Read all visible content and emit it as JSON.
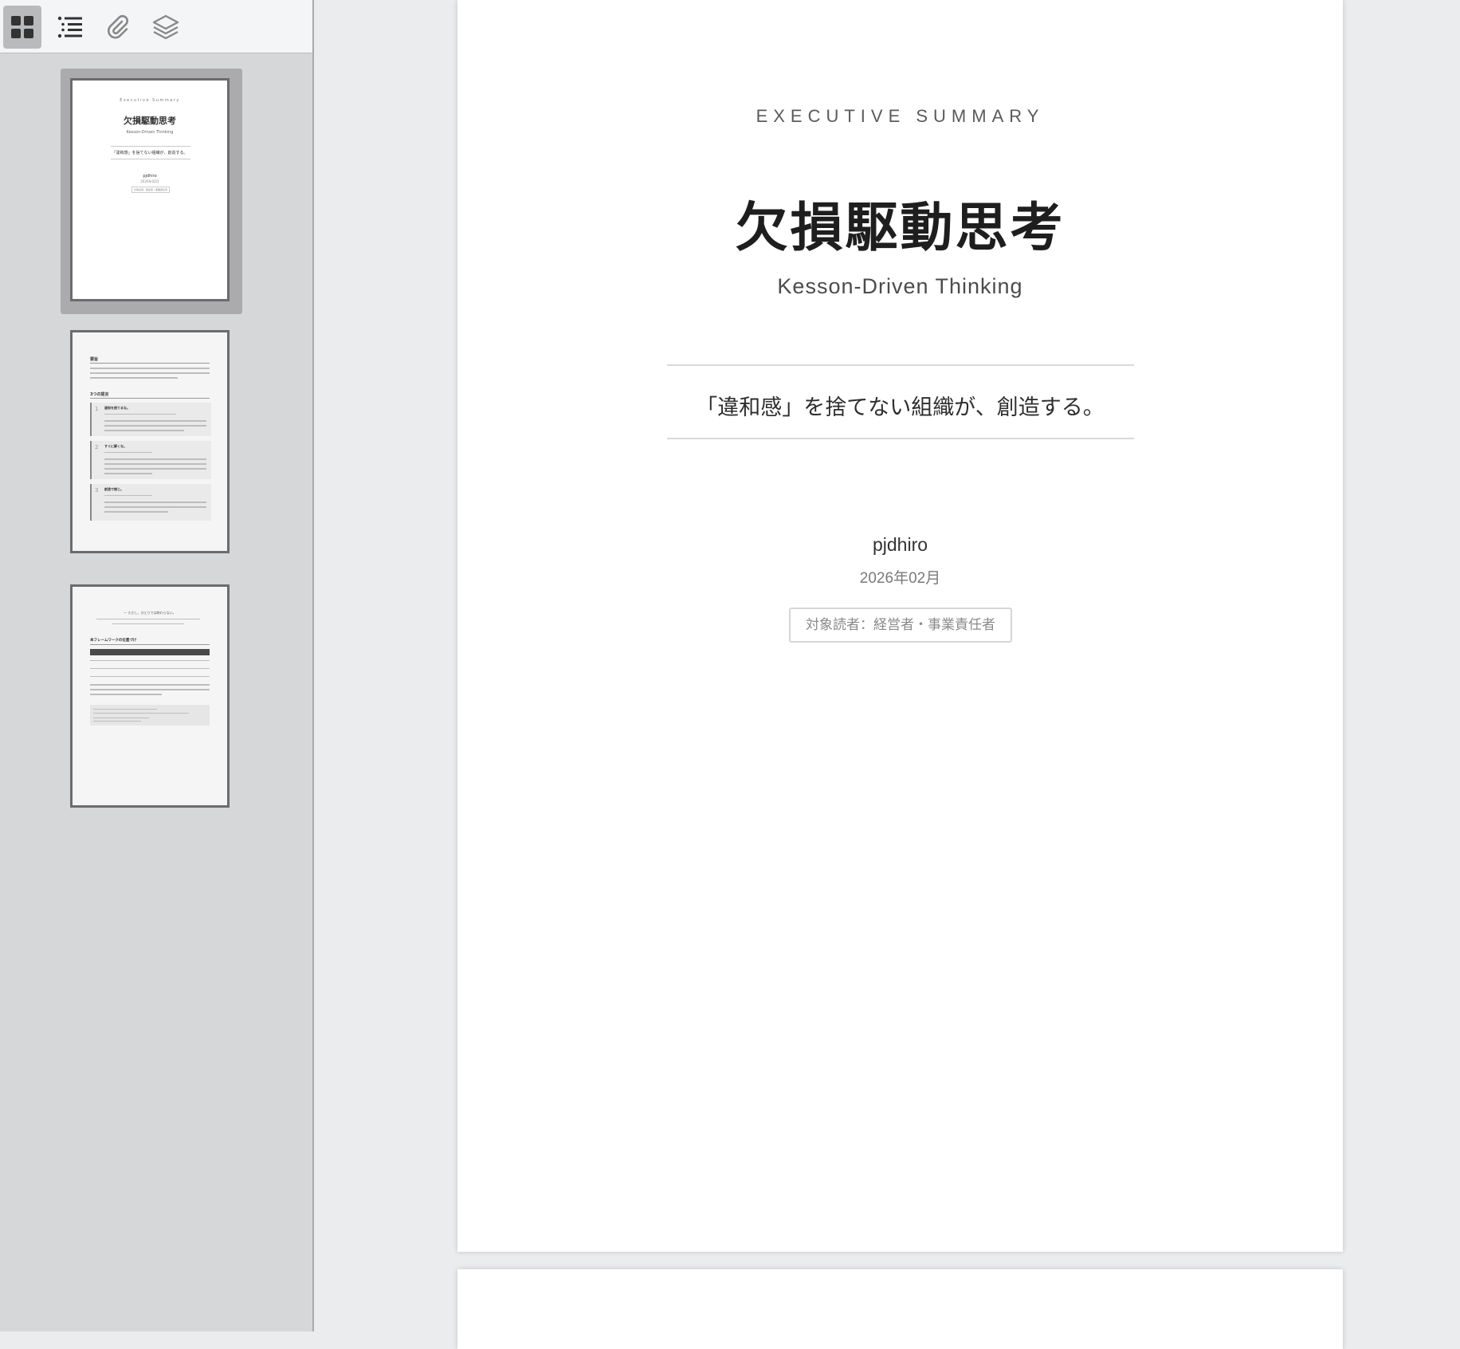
{
  "toolbar": {
    "buttons": [
      {
        "name": "thumbnails",
        "icon": "grid-icon",
        "active": true
      },
      {
        "name": "outline",
        "icon": "list-icon",
        "active": false
      },
      {
        "name": "attachments",
        "icon": "paperclip-icon",
        "active": false
      },
      {
        "name": "layers",
        "icon": "layers-icon",
        "active": false
      }
    ]
  },
  "thumbnails": {
    "selected_page": 1,
    "page1": {
      "eyebrow": "Executive Summary",
      "title": "欠損駆動思考",
      "subtitle": "Kesson-Driven Thinking",
      "tagline": "「違和感」を捨てない組織が、創造する。",
      "author": "pjdhiro",
      "date": "2026年02月",
      "audience": "対象読者：経営者・事業責任者"
    },
    "page2": {
      "heading": "要旨",
      "section": "3つの提言",
      "items": [
        {
          "num": "1",
          "title": "違和を捨てるな。"
        },
        {
          "num": "2",
          "title": "すぐに解くな。"
        },
        {
          "num": "3",
          "title": "創造で閉じ。"
        }
      ]
    },
    "page3": {
      "quote": "— ただし、ひとりでは終わらない。",
      "section": "本フレームワークの位置づけ"
    }
  },
  "document": {
    "eyebrow": "EXECUTIVE SUMMARY",
    "title": "欠損駆動思考",
    "subtitle": "Kesson-Driven Thinking",
    "tagline": "「違和感」を捨てない組織が、創造する。",
    "author": "pjdhiro",
    "date": "2026年02月",
    "audience": "対象読者：経営者・事業責任者"
  }
}
